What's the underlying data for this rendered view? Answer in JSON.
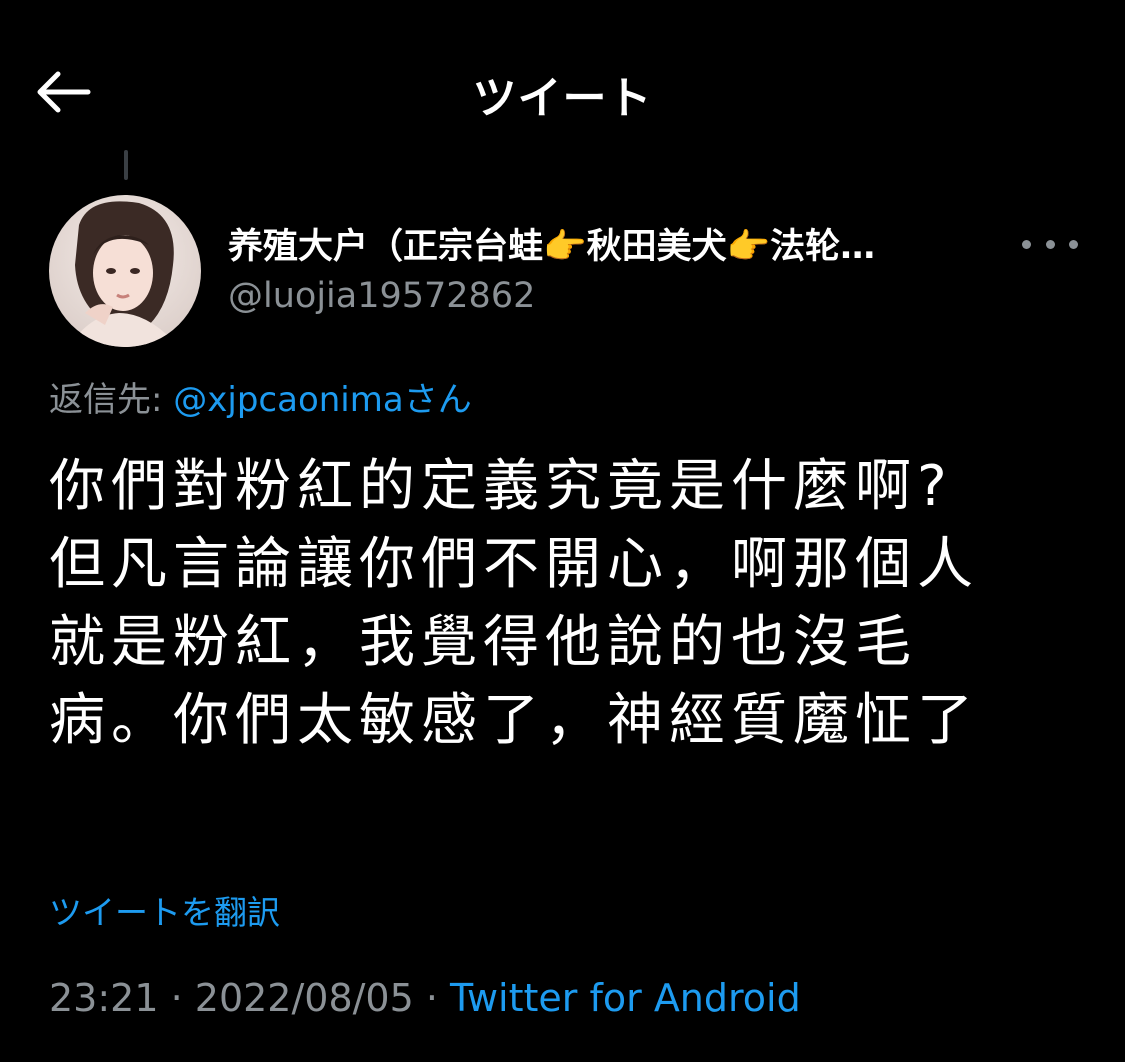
{
  "header": {
    "title": "ツイート",
    "back_icon": "arrow-left-icon"
  },
  "tweet": {
    "author": {
      "display_name": "养殖大户（正宗台蛙👉秋田美犬👉法轮…",
      "handle": "@luojia19572862",
      "avatar_icon": "avatar"
    },
    "reply_to": {
      "prefix": "返信先: ",
      "mention": "@xjpcaonima",
      "suffix": "さん"
    },
    "text_lines": [
      "你們對粉紅的定義究竟是什麼啊?",
      "但凡言論讓你們不開心，啊那個人",
      "就是粉紅，我覺得他說的也沒毛",
      "病。你們太敏感了，神經質魔怔了"
    ],
    "translate_label": "ツイートを翻訳",
    "time": "23:21",
    "separator1": " · ",
    "date": "2022/08/05",
    "separator2": " · ",
    "source": "Twitter for Android"
  },
  "colors": {
    "background": "#000000",
    "text": "#ffffff",
    "secondary": "#8b9196",
    "link": "#1d9bf0"
  }
}
